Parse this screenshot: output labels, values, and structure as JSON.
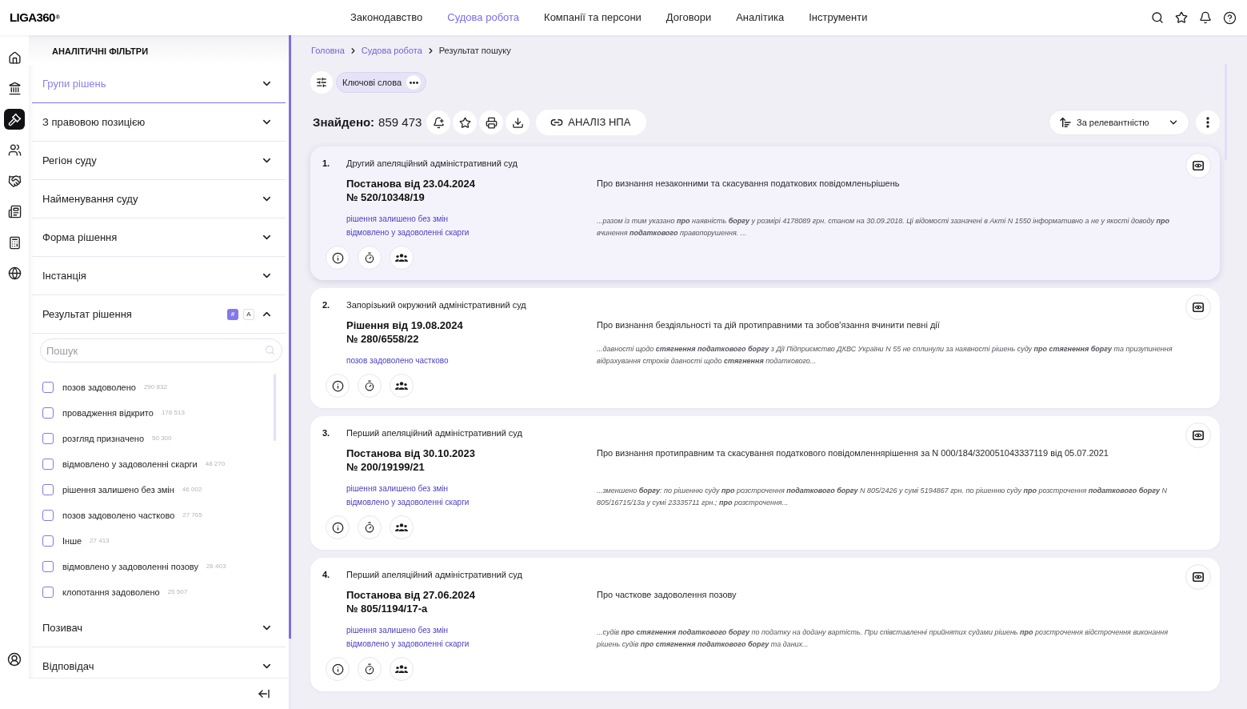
{
  "header": {
    "logo": "LIGA360$^{®}$",
    "nav": [
      {
        "label": "Законодавство",
        "selected": false
      },
      {
        "label": "Судова робота",
        "selected": true
      },
      {
        "label": "Компанії та персони",
        "selected": false
      },
      {
        "label": "Договори",
        "selected": false
      },
      {
        "label": "Аналітика",
        "selected": false
      },
      {
        "label": "Інструменти",
        "selected": false
      }
    ]
  },
  "rail": {
    "items": [
      {
        "selected": false
      },
      {
        "selected": false
      },
      {
        "selected": true
      },
      {
        "selected": false
      },
      {
        "selected": false
      },
      {
        "selected": false
      },
      {
        "selected": false
      },
      {
        "selected": false
      }
    ]
  },
  "filters": {
    "title": "АНАЛІТИЧНІ ФІЛЬТРИ",
    "sections": [
      {
        "label": "Групи рішень",
        "selected": true,
        "expanded": false
      },
      {
        "label": "З правовою позицією",
        "selected": false,
        "expanded": false
      },
      {
        "label": "Регіон суду",
        "selected": false,
        "expanded": false
      },
      {
        "label": "Найменування суду",
        "selected": false,
        "expanded": false
      },
      {
        "label": "Форма рішення",
        "selected": false,
        "expanded": false
      },
      {
        "label": "Інстанція",
        "selected": false,
        "expanded": false
      },
      {
        "label": "Результат рішення",
        "selected": false,
        "expanded": true,
        "badges": [
          {
            "label": "#",
            "selected": true
          },
          {
            "label": "A",
            "selected": false
          }
        ],
        "search": {
          "placeholder": "Пошук"
        },
        "options": [
          {
            "label": "позов задоволено",
            "count": "290 832",
            "checked": false
          },
          {
            "label": "провадження відкрито",
            "count": "178 513",
            "checked": false
          },
          {
            "label": "розгляд призначено",
            "count": "50 300",
            "checked": false
          },
          {
            "label": "відмовлено у задоволенні скарги",
            "count": "48 270",
            "checked": false
          },
          {
            "label": "рішення залишено без змін",
            "count": "46 002",
            "checked": false
          },
          {
            "label": "позов задоволено частково",
            "count": "27 765",
            "checked": false
          },
          {
            "label": "Інше",
            "count": "27 413",
            "checked": false
          },
          {
            "label": "відмовлено у задоволенні позову",
            "count": "26 403",
            "checked": false
          },
          {
            "label": "клопотання задоволено",
            "count": "25 507",
            "checked": false
          }
        ]
      },
      {
        "label": "Позивач",
        "selected": false,
        "expanded": false
      },
      {
        "label": "Відповідач",
        "selected": false,
        "expanded": false
      }
    ]
  },
  "breadcrumb": [
    {
      "label": "Головна",
      "current": false
    },
    {
      "label": "Судова робота",
      "current": false
    },
    {
      "label": "Результат пошуку",
      "current": true
    }
  ],
  "chips": [
    {
      "label": "Ключові слова"
    }
  ],
  "results_bar": {
    "found_label": "Знайдено:",
    "found_count": "859 473",
    "analysis_button": "АНАЛІЗ НПА",
    "sort": "За релевантністю"
  },
  "results": [
    {
      "number": "1.",
      "court": "Другий апеляційний адміністративний суд",
      "title": "Постанова від 23.04.2024",
      "case_number": "№ 520/10348/19",
      "outcomes": [
        "рішення залишено без змін",
        "відмовлено у задоволенні скарги"
      ],
      "summary": "Про визнання незаконними та скасування податкових повідомленьрішень",
      "snippet": "...разом із тим указано **про** наявність **боргу** у розмірі 4178089 грн. станом на 30.09.2018. Ці відомості зазначені в Акті N 1550 інформативно а не у якості доводу **про** вчинення **податкового** правопорушення. ...",
      "highlighted": true
    },
    {
      "number": "2.",
      "court": "Запорізький окружний адміністративний суд",
      "title": "Рішення від 19.08.2024",
      "case_number": "№ 280/6558/22",
      "outcomes": [
        "позов задоволено частково"
      ],
      "summary": "Про визнання бездіяльності та дій протиправними та зобов'язання вчинити певні дії",
      "snippet": "...давності щодо **стягнення податкового боргу** з Дії Підприємство ДКВС України N 55 не сплинули за наявності рішень суду **про стягнення боргу** та призупинення відрахування строків давності щодо **стягнення** податкового...",
      "highlighted": false
    },
    {
      "number": "3.",
      "court": "Перший апеляційний адміністративний суд",
      "title": "Постанова від 30.10.2023",
      "case_number": "№ 200/19199/21",
      "outcomes": [
        "рішення залишено без змін",
        "відмовлено у задоволенні скарги"
      ],
      "summary": "Про визнання протиправним та скасування податкового повідомленнярішення за N 000/184/320051043337119 від 05.07.2021",
      "snippet": "...зменшено **боргу**: по рішенню суду **про** розстрочення **податкового боргу** N 805/2426 у сумі 5194867 грн. по рішенню суду **про** розстрочення **податкового боргу** N 805/16715/13а у сумі 23335711 грн.; **про** розстрочення...",
      "highlighted": false
    },
    {
      "number": "4.",
      "court": "Перший апеляційний адміністративний суд",
      "title": "Постанова від 27.06.2024",
      "case_number": "№ 805/1194/17-а",
      "outcomes": [
        "рішення залишено без змін",
        "відмовлено у задоволенні скарги"
      ],
      "summary": "Про часткове задоволення позову",
      "snippet": "...судів **про стягнення податкового боргу** по податку на додану вартість. При співставленні прийнятих судами рішень **про** розстрочення відстрочення виконання рішень судів **про стягнення податкового боргу** та даних...",
      "highlighted": false
    }
  ]
}
